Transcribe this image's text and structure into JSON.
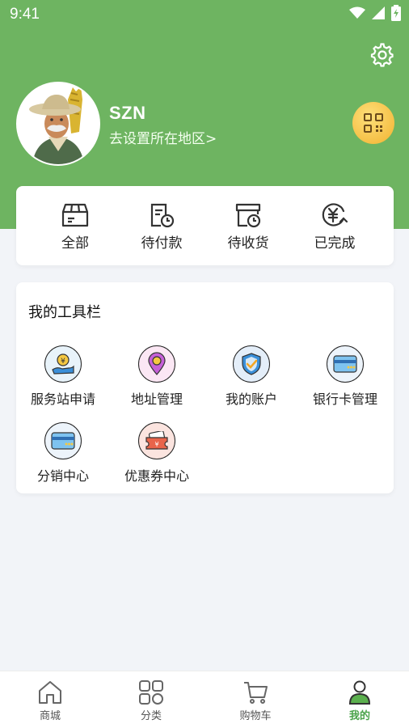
{
  "status_bar": {
    "time": "9:41"
  },
  "profile": {
    "username": "SZN",
    "region_prompt": "去设置所在地区>"
  },
  "orders": {
    "items": [
      {
        "label": "全部",
        "icon": "box-icon"
      },
      {
        "label": "待付款",
        "icon": "bill-clock-icon"
      },
      {
        "label": "待收货",
        "icon": "package-clock-icon"
      },
      {
        "label": "已完成",
        "icon": "yen-refresh-icon"
      }
    ]
  },
  "tools": {
    "title": "我的工具栏",
    "items": [
      {
        "label": "服务站申请",
        "icon": "hand-coin-icon"
      },
      {
        "label": "地址管理",
        "icon": "location-pin-icon"
      },
      {
        "label": "我的账户",
        "icon": "shield-check-icon"
      },
      {
        "label": "银行卡管理",
        "icon": "bank-card-icon"
      },
      {
        "label": "分销中心",
        "icon": "card-icon"
      },
      {
        "label": "优惠券中心",
        "icon": "coupon-icon"
      }
    ]
  },
  "tabbar": {
    "items": [
      {
        "label": "商城",
        "icon": "home-icon"
      },
      {
        "label": "分类",
        "icon": "grid-icon"
      },
      {
        "label": "购物车",
        "icon": "cart-icon"
      },
      {
        "label": "我的",
        "icon": "person-icon",
        "active": true
      }
    ]
  },
  "colors": {
    "header": "#6eb461",
    "accent": "#4aa34a",
    "qr_button": "#f2b230"
  }
}
